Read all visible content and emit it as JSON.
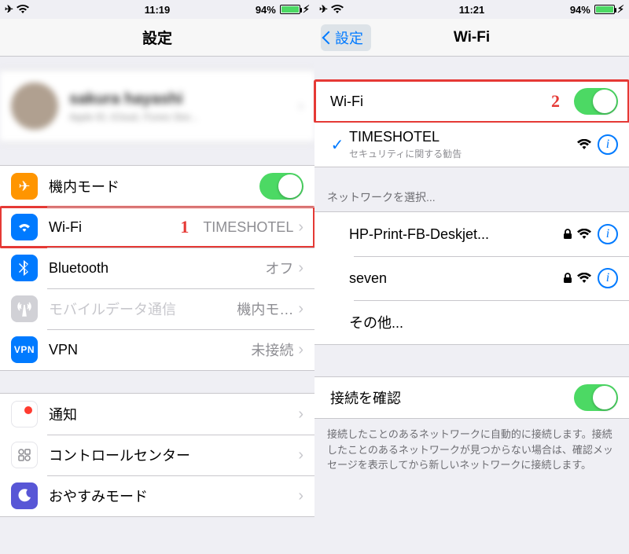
{
  "left": {
    "status": {
      "time": "11:19",
      "battery": "94%"
    },
    "title": "設定",
    "profile": {
      "name": "sakura hayashi",
      "sub": "Apple ID, iCloud, iTunes Stor..."
    },
    "callout": "1",
    "rows": {
      "airplane": "機内モード",
      "wifi": {
        "label": "Wi-Fi",
        "value": "TIMESHOTEL"
      },
      "bluetooth": {
        "label": "Bluetooth",
        "value": "オフ"
      },
      "cellular": {
        "label": "モバイルデータ通信",
        "value": "機内モ…"
      },
      "vpn": {
        "label": "VPN",
        "value": "未接続"
      },
      "notif": "通知",
      "cc": "コントロールセンター",
      "dnd": "おやすみモード"
    },
    "vpn_icon_text": "VPN"
  },
  "right": {
    "status": {
      "time": "11:21",
      "battery": "94%"
    },
    "back": "設定",
    "title": "Wi-Fi",
    "callout": "2",
    "wifi_row_label": "Wi-Fi",
    "connected": {
      "name": "TIMESHOTEL",
      "sub": "セキュリティに関する勧告"
    },
    "section_choose": "ネットワークを選択...",
    "networks": [
      {
        "name": "HP-Print-FB-Deskjet...",
        "locked": true
      },
      {
        "name": "seven",
        "locked": true
      }
    ],
    "other": "その他...",
    "ask": {
      "label": "接続を確認",
      "footer": "接続したことのあるネットワークに自動的に接続します。接続したことのあるネットワークが見つからない場合は、確認メッセージを表示してから新しいネットワークに接続します。"
    }
  }
}
